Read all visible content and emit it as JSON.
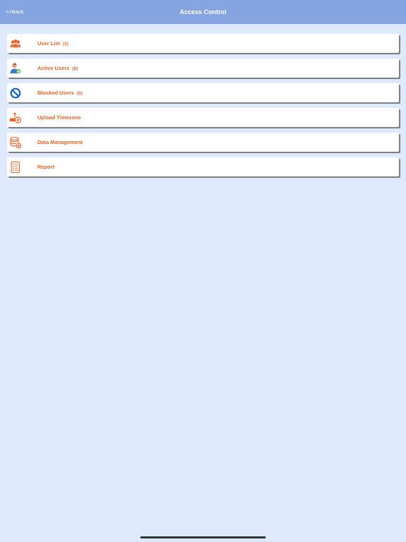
{
  "navbar": {
    "back_label": "<<Back",
    "title": "Access Control"
  },
  "menu": {
    "items": [
      {
        "label": "User List",
        "count": "(1)",
        "icon": "users-group-icon"
      },
      {
        "label": "Active Users",
        "count": "(0)",
        "icon": "active-user-icon"
      },
      {
        "label": "Blocked Users",
        "count": "(0)",
        "icon": "blocked-icon"
      },
      {
        "label": "Upload Timezone",
        "count": "",
        "icon": "upload-timezone-icon"
      },
      {
        "label": "Data Management",
        "count": "",
        "icon": "database-add-icon"
      },
      {
        "label": "Report",
        "count": "",
        "icon": "report-icon"
      }
    ]
  },
  "colors": {
    "navbar": "#86a4e0",
    "background": "#dfe9fd",
    "accent": "#e8652a",
    "blocked_icon": "#1464c8"
  }
}
